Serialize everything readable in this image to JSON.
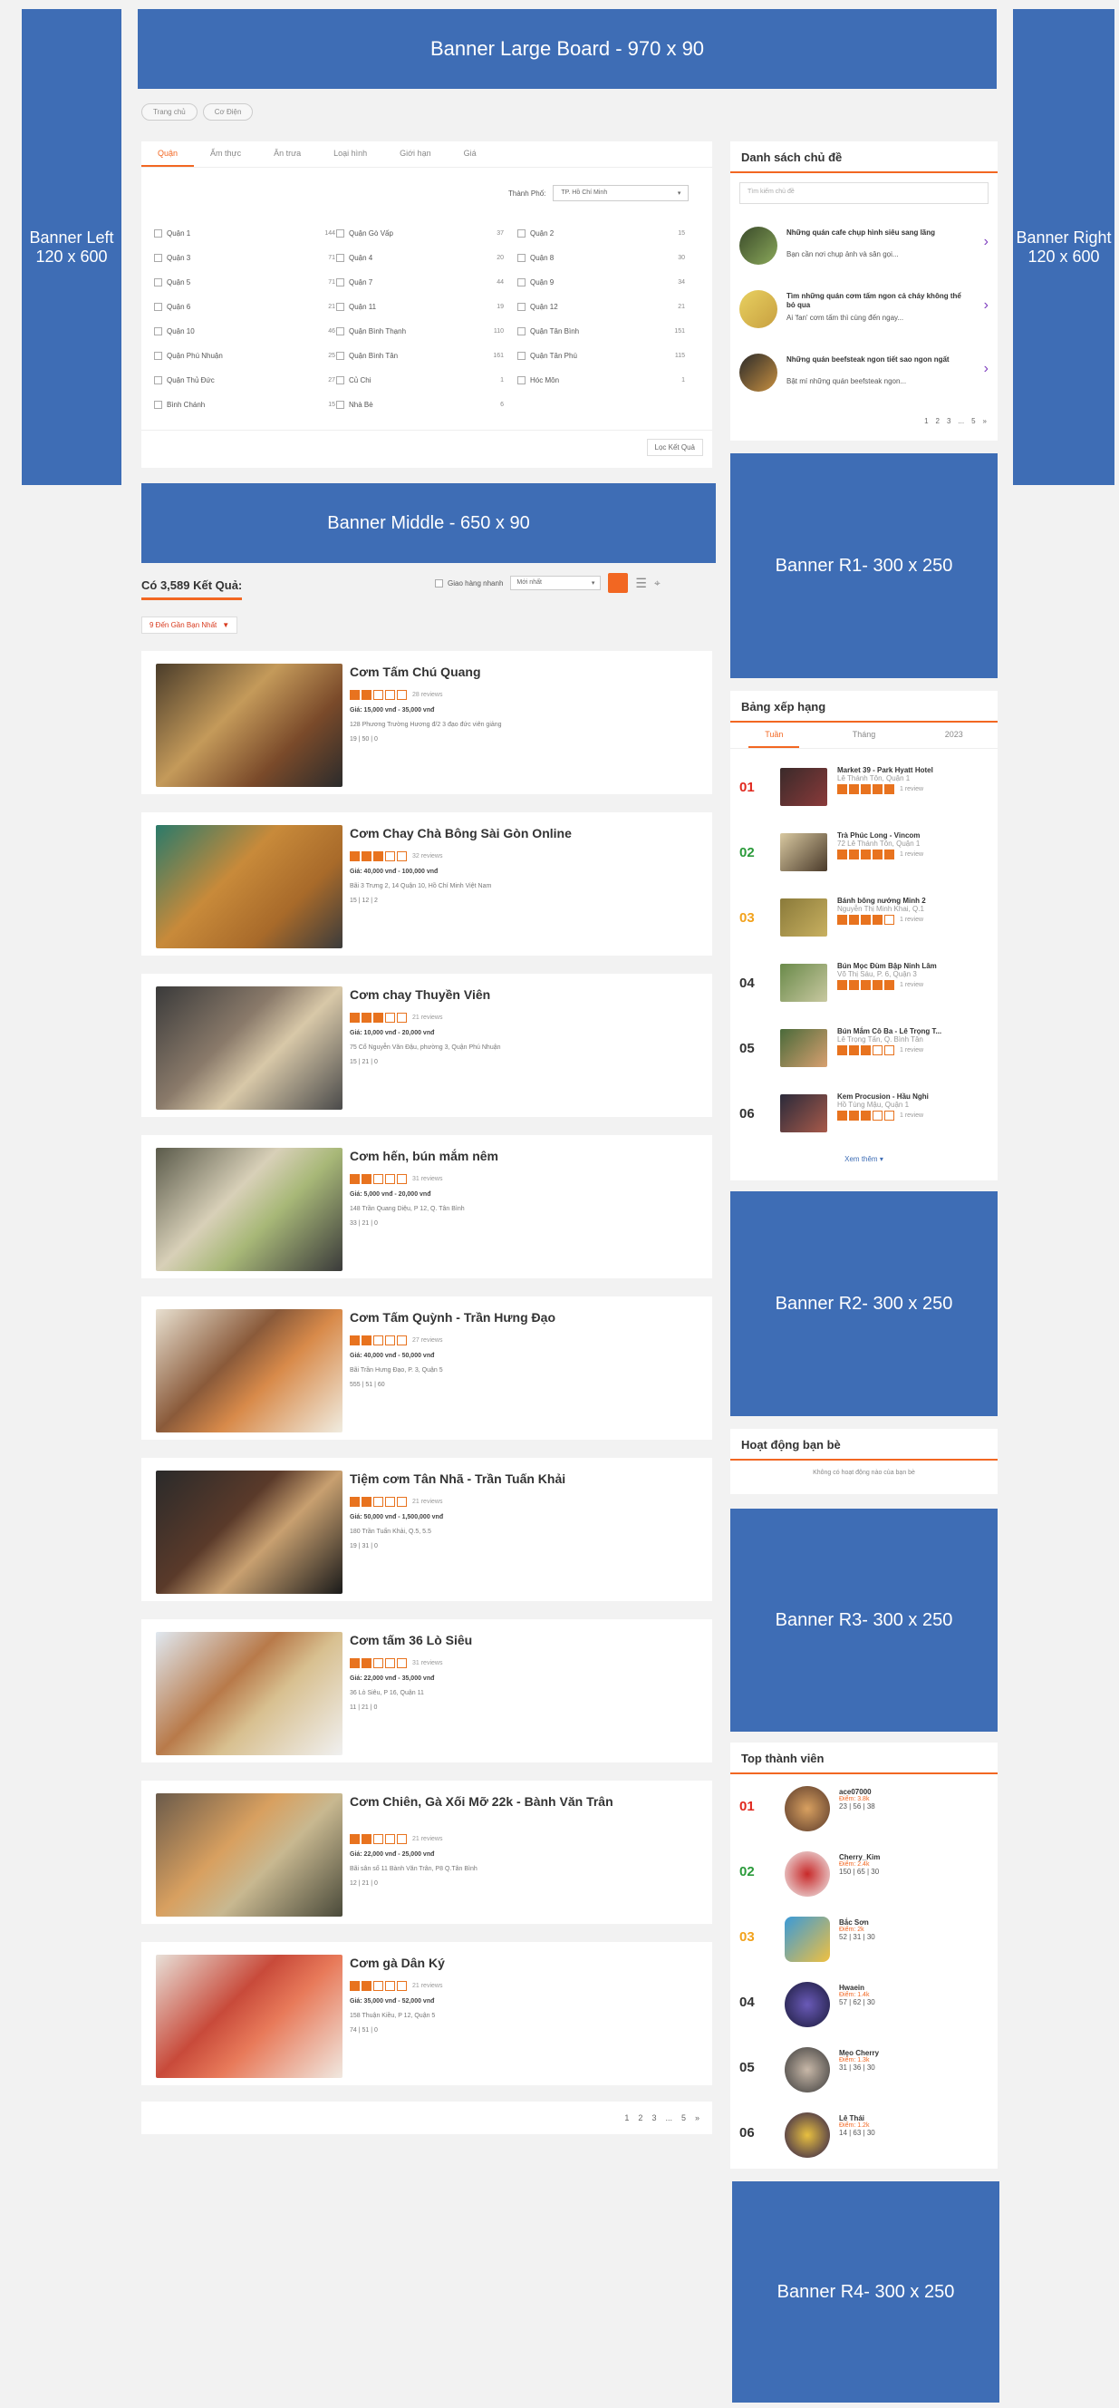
{
  "banners": {
    "large_board": "Banner Large Board - 970 x 90",
    "left": "Banner Left 120 x 600",
    "right": "Banner Right 120 x 600",
    "middle": "Banner Middle - 650 x 90",
    "r1": "Banner R1- 300 x 250",
    "r2": "Banner R2- 300 x 250",
    "r3": "Banner R3- 300 x 250",
    "r4": "Banner R4- 300 x 250"
  },
  "breadcrumb": [
    "Trang chủ",
    "Cơ Điện"
  ],
  "filter": {
    "tabs": [
      "Quận",
      "Ẩm thực",
      "Ăn trưa",
      "Loại hình",
      "Giới hạn",
      "Giá"
    ],
    "city_label": "Thành Phố:",
    "city_value": "TP. Hồ Chí Minh",
    "columns": [
      [
        {
          "label": "Quận 1",
          "count": "144"
        },
        {
          "label": "Quận 3",
          "count": "71"
        },
        {
          "label": "Quận 5",
          "count": "71"
        },
        {
          "label": "Quận 6",
          "count": "21"
        },
        {
          "label": "Quận 10",
          "count": "46"
        },
        {
          "label": "Quận Phú Nhuận",
          "count": "25"
        },
        {
          "label": "Quận Thủ Đức",
          "count": "27"
        },
        {
          "label": "Bình Chánh",
          "count": "15"
        }
      ],
      [
        {
          "label": "Quận Gò Vấp",
          "count": "37"
        },
        {
          "label": "Quận 4",
          "count": "20"
        },
        {
          "label": "Quận 7",
          "count": "44"
        },
        {
          "label": "Quận 11",
          "count": "19"
        },
        {
          "label": "Quận Bình Thạnh",
          "count": "110"
        },
        {
          "label": "Quận Bình Tân",
          "count": "161"
        },
        {
          "label": "Củ Chi",
          "count": "1"
        },
        {
          "label": "Nhà Bè",
          "count": "6"
        }
      ],
      [
        {
          "label": "Quận 2",
          "count": "15"
        },
        {
          "label": "Quận 8",
          "count": "30"
        },
        {
          "label": "Quận 9",
          "count": "34"
        },
        {
          "label": "Quận 12",
          "count": "21"
        },
        {
          "label": "Quận Tân Bình",
          "count": "151"
        },
        {
          "label": "Quận Tân Phú",
          "count": "115"
        },
        {
          "label": "Hóc Môn",
          "count": "1"
        }
      ]
    ],
    "apply_button": "Lọc Kết Quả"
  },
  "results": {
    "count_label": "Có 3,589 Kết Quả:",
    "filter_checkbox": "Giao hàng nhanh",
    "sort_value": "Mới nhất",
    "district_dropdown": "9 Đến Gần Bạn Nhất",
    "pagination": [
      "1",
      "2",
      "3",
      "...",
      "5",
      "»"
    ],
    "items": [
      {
        "title": "Cơm Tấm Chú Quang",
        "reviews": "28 reviews",
        "price": "Giá: 15,000 vnđ - 35,000 vnđ",
        "address": "128 Phương Trường Hương đ/2 3 đạo đức viên giảng",
        "stats": "19 | 50 | 0"
      },
      {
        "title": "Cơm Chay Chà Bông Sài Gòn Online",
        "reviews": "32 reviews",
        "price": "Giá: 40,000 vnđ - 100,000 vnđ",
        "address": "Bãi 3 Trưng 2, 14 Quận 10, Hồ Chí Minh Việt Nam",
        "stats": "15 | 12 | 2"
      },
      {
        "title": "Cơm chay Thuyền Viên",
        "reviews": "21 reviews",
        "price": "Giá: 10,000 vnđ - 20,000 vnđ",
        "address": "75 Cổ Nguyễn Văn Đậu, phường 3, Quận Phú Nhuận",
        "stats": "15 | 21 | 0"
      },
      {
        "title": "Cơm hến, bún mắm nêm",
        "reviews": "31 reviews",
        "price": "Giá: 5,000 vnđ - 20,000 vnđ",
        "address": "148 Trần Quang Diệu, P 12, Q. Tân Bình",
        "stats": "33 | 21 | 0"
      },
      {
        "title": "Cơm Tấm Quỳnh - Trần Hưng Đạo",
        "reviews": "27 reviews",
        "price": "Giá: 40,000 vnđ - 50,000 vnđ",
        "address": "Bãi Trần Hưng Đạo, P. 3, Quận 5",
        "stats": "555 | 51 | 60"
      },
      {
        "title": "Tiệm cơm Tân Nhã - Trần Tuấn Khải",
        "reviews": "21 reviews",
        "price": "Giá: 50,000 vnđ - 1,500,000 vnđ",
        "address": "180 Trần Tuấn Khải, Q.5, 5.5",
        "stats": "19 | 31 | 0"
      },
      {
        "title": "Cơm tấm 36 Lò Siêu",
        "reviews": "31 reviews",
        "price": "Giá: 22,000 vnđ - 35,000 vnđ",
        "address": "36 Lò Siêu, P 16, Quận 11",
        "stats": "11 | 21 | 0"
      },
      {
        "title": "Cơm Chiên, Gà Xối Mỡ 22k - Bành Văn Trân",
        "reviews": "21 reviews",
        "price": "Giá: 22,000 vnđ - 25,000 vnđ",
        "address": "Bãi sân số 11 Bành Văn Trân, P8 Q.Tân Bình",
        "stats": "12 | 21 | 0"
      },
      {
        "title": "Cơm gà Dân Ký",
        "reviews": "21 reviews",
        "price": "Giá: 35,000 vnđ - 52,000 vnđ",
        "address": "158 Thuận Kiều, P 12, Quận 5",
        "stats": "74 | 51 | 0"
      }
    ]
  },
  "topics": {
    "title": "Danh sách chủ đề",
    "search_placeholder": "Tìm kiếm chủ đề",
    "items": [
      {
        "title": "Những quán cafe chụp hình siêu sang lãng",
        "desc": "Bạn cần nơi chụp ảnh và sân gọi..."
      },
      {
        "title": "Tìm những quán cơm tấm ngon cả cháy không thể bỏ qua",
        "desc": "Ai 'fan' cơm tấm thì cùng đến ngay..."
      },
      {
        "title": "Những quán beefsteak ngon tiết sao ngon ngất",
        "desc": "Bật mí những quán beefsteak ngon..."
      }
    ],
    "pagination": [
      "1",
      "2",
      "3",
      "...",
      "5",
      "»"
    ]
  },
  "ranking": {
    "title": "Bảng xếp hạng",
    "tabs": [
      "Tuần",
      "Tháng",
      "2023"
    ],
    "items": [
      {
        "rank": "01",
        "name": "Market 39 - Park Hyatt Hotel",
        "addr": "Lê Thánh Tôn, Quận 1",
        "reviews": "1 review",
        "color": "#e0281e"
      },
      {
        "rank": "02",
        "name": "Trà Phúc Long - Vincom",
        "addr": "72 Lê Thánh Tôn, Quận 1",
        "reviews": "1 review",
        "color": "#2a9a3a"
      },
      {
        "rank": "03",
        "name": "Bánh bông nướng Minh 2",
        "addr": "Nguyễn Thị Minh Khai, Q.1",
        "reviews": "1 review",
        "color": "#f2a21c"
      },
      {
        "rank": "04",
        "name": "Bún Mọc Đùm Bập Ninh Lâm",
        "addr": "Võ Thị Sáu, P. 6, Quận 3",
        "reviews": "1 review",
        "color": "#333333"
      },
      {
        "rank": "05",
        "name": "Bún Mắm Cô Ba - Lê Trọng T...",
        "addr": "Lê Trọng Tấn, Q. Bình Tân",
        "reviews": "1 review",
        "color": "#333333"
      },
      {
        "rank": "06",
        "name": "Kem Procusion - Hầu Nghi",
        "addr": "Hồ Tùng Mậu, Quận 1",
        "reviews": "1 review",
        "color": "#333333"
      }
    ],
    "more": "Xem thêm"
  },
  "friends": {
    "title": "Hoạt động bạn bè",
    "empty": "Không có hoạt động nào của bạn bè"
  },
  "members": {
    "title": "Top thành viên",
    "items": [
      {
        "rank": "01",
        "name": "ace07000",
        "points": "Điểm: 3.8k",
        "stats": "23 | 56 | 38",
        "color": "#e0281e"
      },
      {
        "rank": "02",
        "name": "Cherry_Kim",
        "points": "Điểm: 2.4k",
        "stats": "150 | 65 | 30",
        "color": "#2a9a3a"
      },
      {
        "rank": "03",
        "name": "Bắc Sơn",
        "points": "Điểm: 2k",
        "stats": "52 | 31 | 30",
        "color": "#f2a21c"
      },
      {
        "rank": "04",
        "name": "Hwaein",
        "points": "Điểm: 1.4k",
        "stats": "57 | 62 | 30",
        "color": "#333333"
      },
      {
        "rank": "05",
        "name": "Mẹo Cherry",
        "points": "Điểm: 1.3k",
        "stats": "31 | 36 | 30",
        "color": "#333333"
      },
      {
        "rank": "06",
        "name": "Lê Thái",
        "points": "Điểm: 1.2k",
        "stats": "14 | 63 | 30",
        "color": "#333333"
      }
    ]
  },
  "colors": {
    "accent": "#f26722",
    "banner": "#3e6db5"
  }
}
